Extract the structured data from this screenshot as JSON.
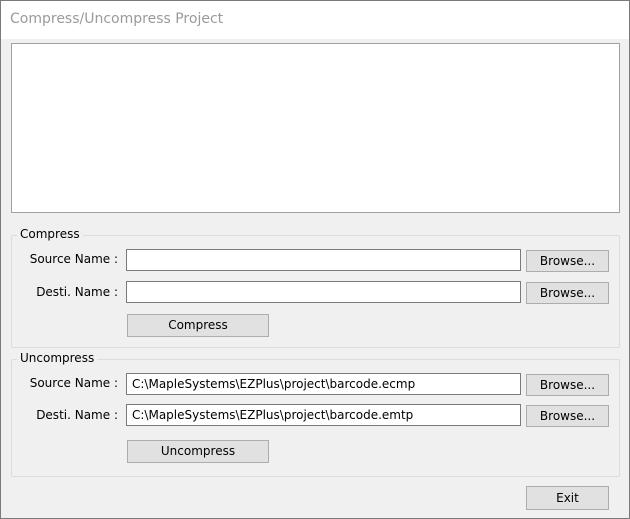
{
  "window": {
    "title": "Compress/Uncompress Project"
  },
  "compress": {
    "group_label": "Compress",
    "source_label": "Source Name :",
    "source_value": "",
    "dest_label": "Desti. Name :",
    "dest_value": "",
    "browse_label": "Browse...",
    "action_label": "Compress"
  },
  "uncompress": {
    "group_label": "Uncompress",
    "source_label": "Source Name :",
    "source_value": "C:\\MapleSystems\\EZPlus\\project\\barcode.ecmp",
    "dest_label": "Desti. Name :",
    "dest_value": "C:\\MapleSystems\\EZPlus\\project\\barcode.emtp",
    "browse_label": "Browse...",
    "action_label": "Uncompress"
  },
  "footer": {
    "exit_label": "Exit"
  }
}
